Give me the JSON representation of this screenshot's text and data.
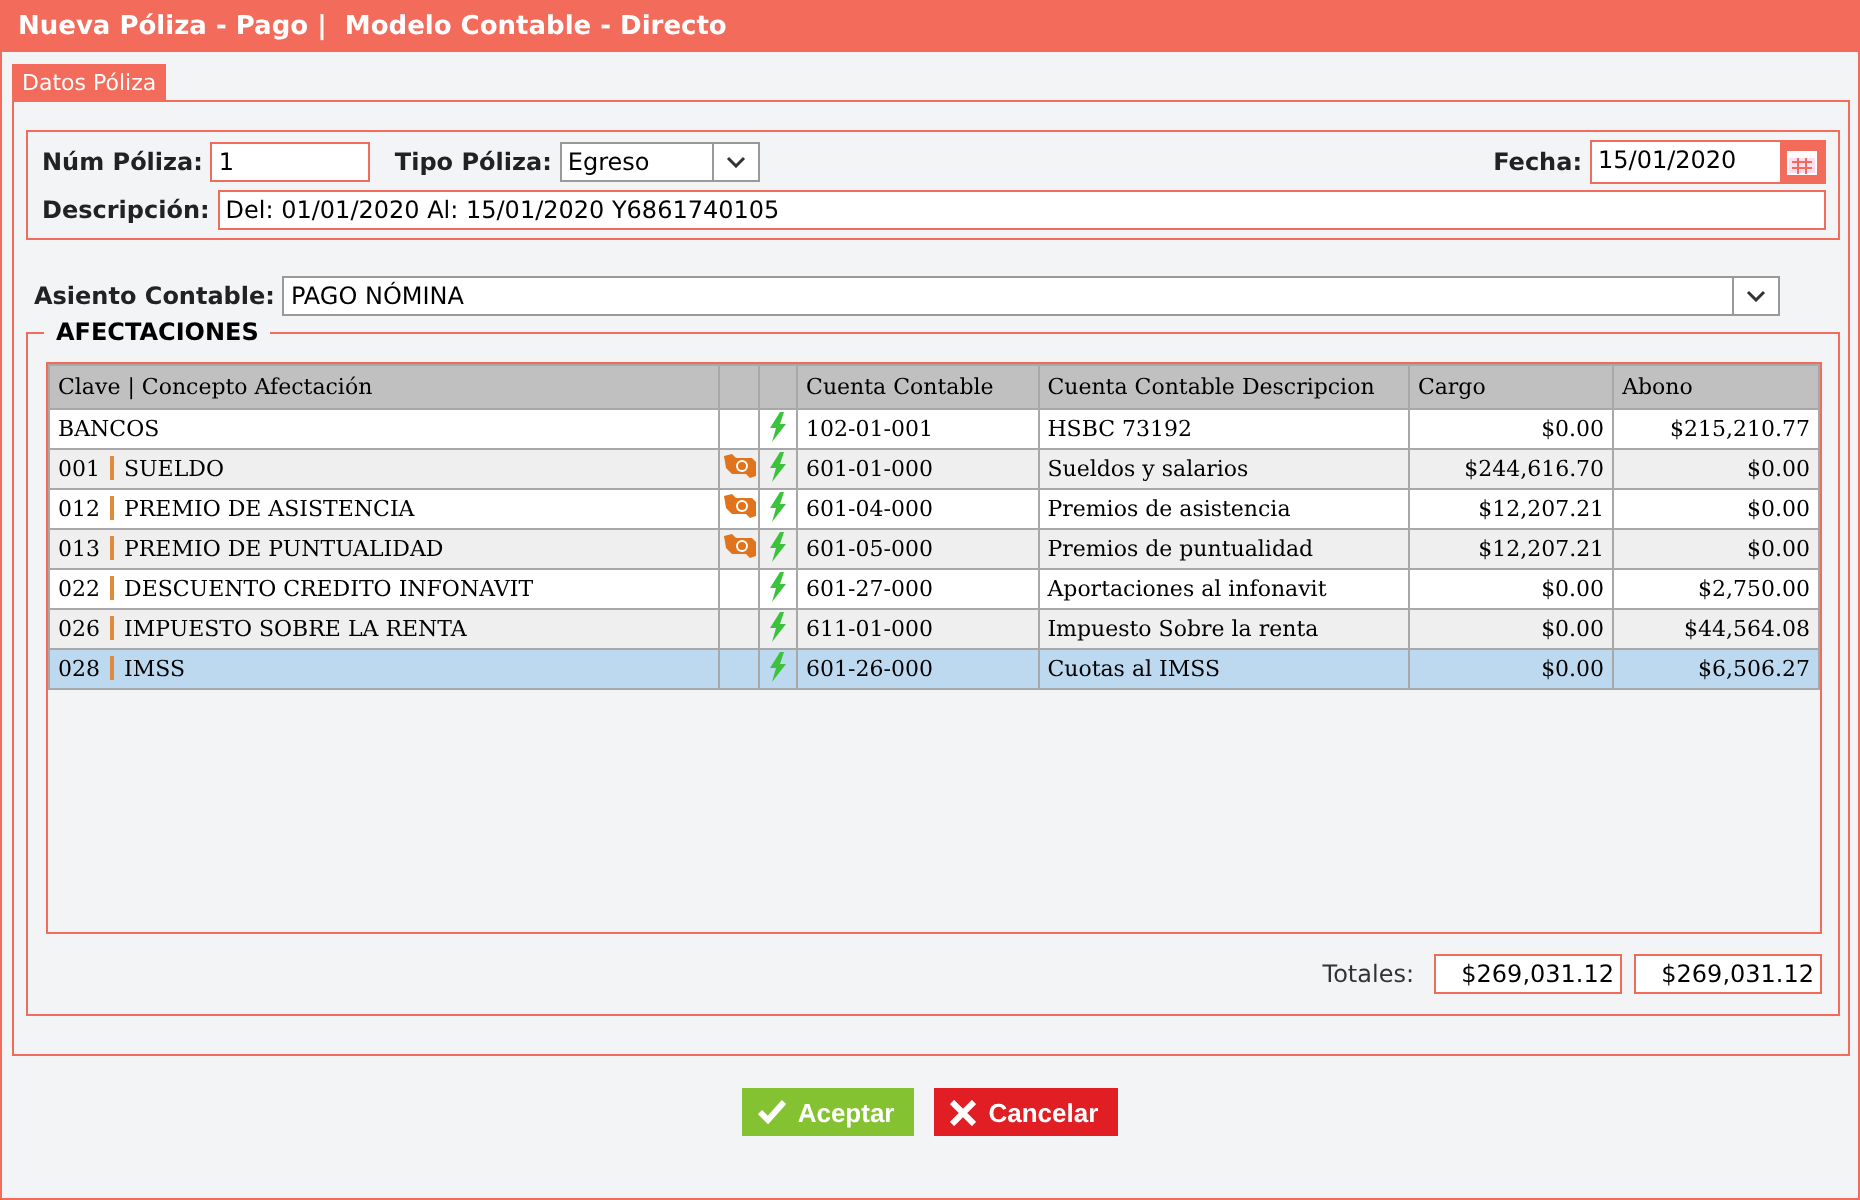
{
  "window": {
    "title": "Nueva Póliza - Pago |  Modelo Contable - Directo"
  },
  "tabs": [
    {
      "label": "Datos Póliza",
      "selected": true
    }
  ],
  "poliza": {
    "num_label": "Núm Póliza:",
    "num_value": "1",
    "tipo_label": "Tipo Póliza:",
    "tipo_value": "Egreso",
    "fecha_label": "Fecha:",
    "fecha_value": "15/01/2020",
    "descripcion_label": "Descripción:",
    "descripcion_value": "Del: 01/01/2020  Al: 15/01/2020 Y6861740105"
  },
  "asiento": {
    "label": "Asiento Contable:",
    "value": "PAGO NÓMINA"
  },
  "afectaciones": {
    "title": "AFECTACIONES",
    "columns": [
      "Clave | Concepto Afectación",
      "Cuenta Contable",
      "Cuenta Contable Descripcion",
      "Cargo",
      "Abono"
    ],
    "rows": [
      {
        "clave": "",
        "concepto": "BANCOS",
        "money": false,
        "cuenta": "102-01-001",
        "descripcion": "HSBC 73192",
        "cargo": "$0.00",
        "abono": "$215,210.77",
        "selected": false
      },
      {
        "clave": "001",
        "concepto": "SUELDO",
        "money": true,
        "cuenta": "601-01-000",
        "descripcion": "Sueldos y salarios",
        "cargo": "$244,616.70",
        "abono": "$0.00",
        "selected": false
      },
      {
        "clave": "012",
        "concepto": "PREMIO DE ASISTENCIA",
        "money": true,
        "cuenta": "601-04-000",
        "descripcion": "Premios de asistencia",
        "cargo": "$12,207.21",
        "abono": "$0.00",
        "selected": false
      },
      {
        "clave": "013",
        "concepto": "PREMIO DE PUNTUALIDAD",
        "money": true,
        "cuenta": "601-05-000",
        "descripcion": "Premios de puntualidad",
        "cargo": "$12,207.21",
        "abono": "$0.00",
        "selected": false
      },
      {
        "clave": "022",
        "concepto": "DESCUENTO CREDITO INFONAVIT",
        "money": false,
        "cuenta": "601-27-000",
        "descripcion": "Aportaciones al infonavit",
        "cargo": "$0.00",
        "abono": "$2,750.00",
        "selected": false
      },
      {
        "clave": "026",
        "concepto": "IMPUESTO SOBRE LA RENTA",
        "money": false,
        "cuenta": "611-01-000",
        "descripcion": "Impuesto Sobre la renta",
        "cargo": "$0.00",
        "abono": "$44,564.08",
        "selected": false
      },
      {
        "clave": "028",
        "concepto": "IMSS",
        "money": false,
        "cuenta": "601-26-000",
        "descripcion": "Cuotas al IMSS",
        "cargo": "$0.00",
        "abono": "$6,506.27",
        "selected": true
      }
    ],
    "totales_label": "Totales:",
    "total_cargo": "$269,031.12",
    "total_abono": "$269,031.12"
  },
  "buttons": [
    {
      "kind": "accept",
      "label": "Aceptar"
    },
    {
      "kind": "cancel",
      "label": "Cancelar"
    }
  ]
}
